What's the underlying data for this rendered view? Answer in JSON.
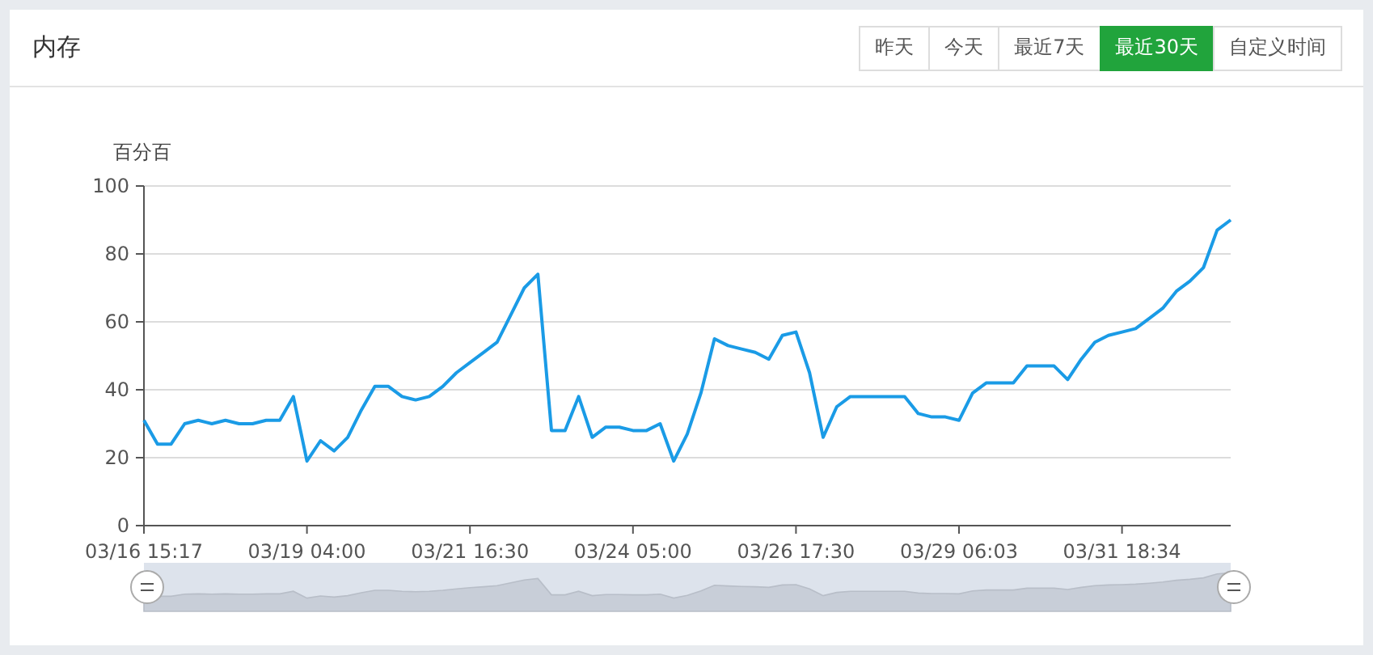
{
  "panel": {
    "title": "内存"
  },
  "ranges": [
    {
      "label": "昨天",
      "selected": false
    },
    {
      "label": "今天",
      "selected": false
    },
    {
      "label": "最近7天",
      "selected": false
    },
    {
      "label": "最近30天",
      "selected": true
    },
    {
      "label": "自定义时间",
      "selected": false
    }
  ],
  "chart_data": {
    "type": "line",
    "grid": true,
    "ylabel": "百分百",
    "ylim": [
      0,
      100
    ],
    "yticks": [
      0,
      20,
      40,
      60,
      80,
      100
    ],
    "categories": [
      "03/16 15:17",
      null,
      null,
      null,
      null,
      null,
      null,
      null,
      null,
      null,
      null,
      null,
      "03/19 04:00",
      null,
      null,
      null,
      null,
      null,
      null,
      null,
      null,
      null,
      null,
      null,
      "03/21 16:30",
      null,
      null,
      null,
      null,
      null,
      null,
      null,
      null,
      null,
      null,
      null,
      "03/24 05:00",
      null,
      null,
      null,
      null,
      null,
      null,
      null,
      null,
      null,
      null,
      null,
      "03/26 17:30",
      null,
      null,
      null,
      null,
      null,
      null,
      null,
      null,
      null,
      null,
      null,
      "03/29 06:03",
      null,
      null,
      null,
      null,
      null,
      null,
      null,
      null,
      null,
      null,
      null,
      "03/31 18:34",
      null,
      null,
      null,
      null,
      null,
      null,
      null,
      null
    ],
    "series": [
      {
        "color": "#1a9be6",
        "values": [
          31,
          24,
          24,
          30,
          31,
          30,
          31,
          30,
          30,
          31,
          31,
          38,
          19,
          25,
          22,
          26,
          34,
          41,
          41,
          38,
          37,
          38,
          41,
          45,
          48,
          51,
          54,
          62,
          70,
          74,
          28,
          28,
          38,
          26,
          29,
          29,
          28,
          28,
          30,
          19,
          27,
          39,
          55,
          53,
          52,
          51,
          49,
          56,
          57,
          45,
          26,
          35,
          38,
          38,
          38,
          38,
          38,
          33,
          32,
          32,
          31,
          39,
          42,
          42,
          42,
          47,
          47,
          47,
          43,
          49,
          54,
          56,
          57,
          58,
          61,
          64,
          69,
          72,
          76,
          87,
          90
        ]
      }
    ]
  }
}
